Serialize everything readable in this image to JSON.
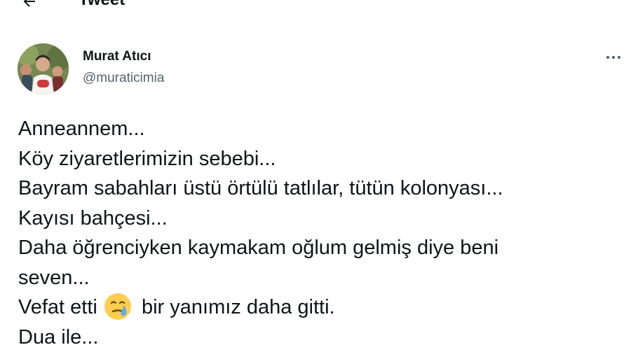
{
  "header": {
    "title": "Tweet"
  },
  "author": {
    "name": "Murat Atıcı",
    "handle": "@muraticimia"
  },
  "icons": {
    "back": "arrow-left-icon",
    "more": "more-horizontal-icon",
    "emoji": "crying-face-emoji"
  },
  "tweet": {
    "lines": [
      "Anneannem...",
      "Köy ziyaretlerimizin sebebi...",
      "Bayram sabahları üstü örtülü tatlılar, tütün kolonyası...",
      "Kayısı bahçesi...",
      "Daha öğrenciyken kaymakam oğlum gelmiş diye beni",
      "seven...",
      "Vefat etti",
      " bir yanımız daha gitti.",
      "Dua ile..."
    ]
  },
  "colors": {
    "text": "#0f1419",
    "secondary": "#536471",
    "emoji": "#ffcc4d",
    "tear": "#5dadec"
  }
}
